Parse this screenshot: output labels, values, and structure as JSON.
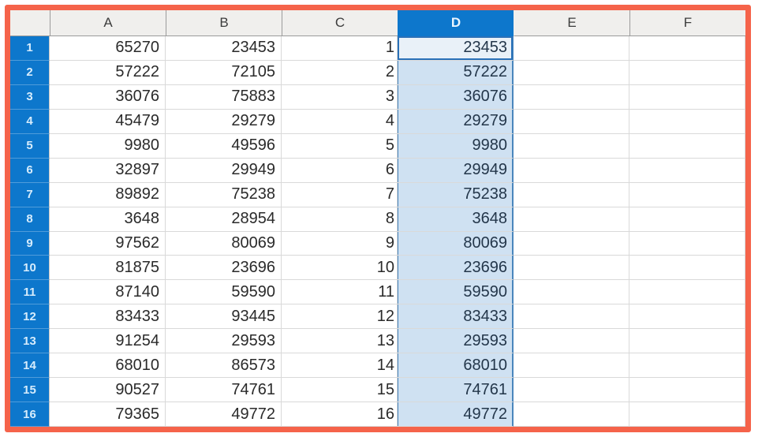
{
  "spreadsheet": {
    "corner_label": "",
    "column_headers": [
      "A",
      "B",
      "C",
      "D",
      "E",
      "F"
    ],
    "selected_column": "D",
    "active_cell": "D1",
    "rows": [
      {
        "r": "1",
        "cells": [
          "65270",
          "23453",
          "1",
          "23453",
          "",
          ""
        ]
      },
      {
        "r": "2",
        "cells": [
          "57222",
          "72105",
          "2",
          "57222",
          "",
          ""
        ]
      },
      {
        "r": "3",
        "cells": [
          "36076",
          "75883",
          "3",
          "36076",
          "",
          ""
        ]
      },
      {
        "r": "4",
        "cells": [
          "45479",
          "29279",
          "4",
          "29279",
          "",
          ""
        ]
      },
      {
        "r": "5",
        "cells": [
          "9980",
          "49596",
          "5",
          "9980",
          "",
          ""
        ]
      },
      {
        "r": "6",
        "cells": [
          "32897",
          "29949",
          "6",
          "29949",
          "",
          ""
        ]
      },
      {
        "r": "7",
        "cells": [
          "89892",
          "75238",
          "7",
          "75238",
          "",
          ""
        ]
      },
      {
        "r": "8",
        "cells": [
          "3648",
          "28954",
          "8",
          "3648",
          "",
          ""
        ]
      },
      {
        "r": "9",
        "cells": [
          "97562",
          "80069",
          "9",
          "80069",
          "",
          ""
        ]
      },
      {
        "r": "10",
        "cells": [
          "81875",
          "23696",
          "10",
          "23696",
          "",
          ""
        ]
      },
      {
        "r": "11",
        "cells": [
          "87140",
          "59590",
          "11",
          "59590",
          "",
          ""
        ]
      },
      {
        "r": "12",
        "cells": [
          "83433",
          "93445",
          "12",
          "83433",
          "",
          ""
        ]
      },
      {
        "r": "13",
        "cells": [
          "91254",
          "29593",
          "13",
          "29593",
          "",
          ""
        ]
      },
      {
        "r": "14",
        "cells": [
          "68010",
          "86573",
          "14",
          "68010",
          "",
          ""
        ]
      },
      {
        "r": "15",
        "cells": [
          "90527",
          "74761",
          "15",
          "74761",
          "",
          ""
        ]
      },
      {
        "r": "16",
        "cells": [
          "79365",
          "49772",
          "16",
          "49772",
          "",
          ""
        ]
      }
    ]
  },
  "colors": {
    "annotation_frame": "#f5634a",
    "header_blue": "#0d77cc",
    "selection_fill": "#cfe1f2",
    "active_cell_fill": "#e9f1f8",
    "selection_edge": "#4a86bd",
    "header_gray": "#f0efed",
    "gridline": "#d9d9d9",
    "cell_text": "#2a2a2a"
  }
}
